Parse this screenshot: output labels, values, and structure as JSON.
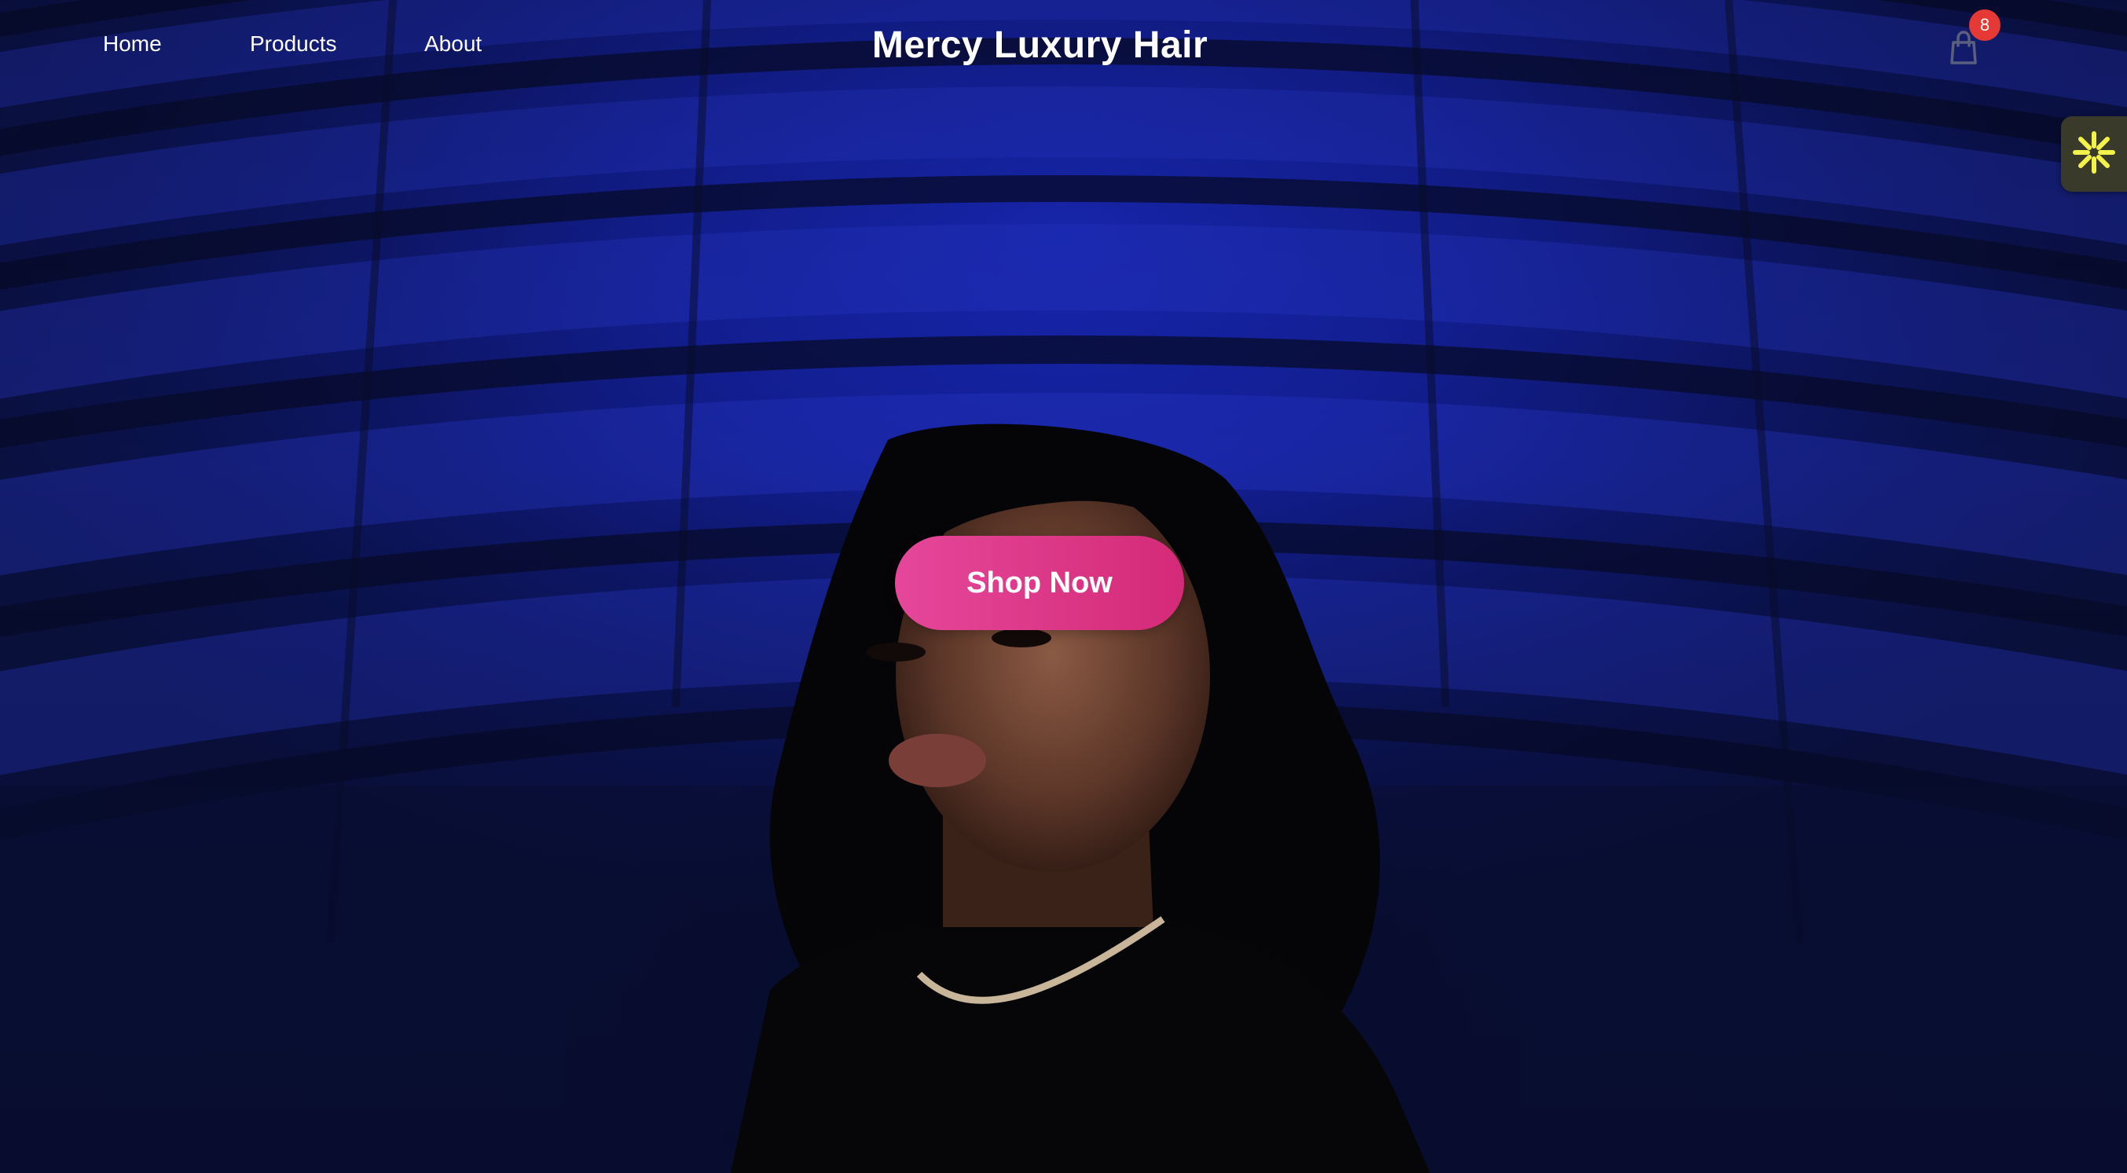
{
  "header": {
    "nav": {
      "home": "Home",
      "products": "Products",
      "about": "About"
    },
    "brand": "Mercy Luxury Hair",
    "cart": {
      "icon": "shopping-bag-icon",
      "count": "8"
    }
  },
  "hero": {
    "cta_label": "Shop Now"
  },
  "widget": {
    "icon": "sparkle-icon"
  },
  "colors": {
    "accent": "#d83a86",
    "badge": "#e53935",
    "background": "#1421a0",
    "widget_icon": "#f2f24a"
  }
}
